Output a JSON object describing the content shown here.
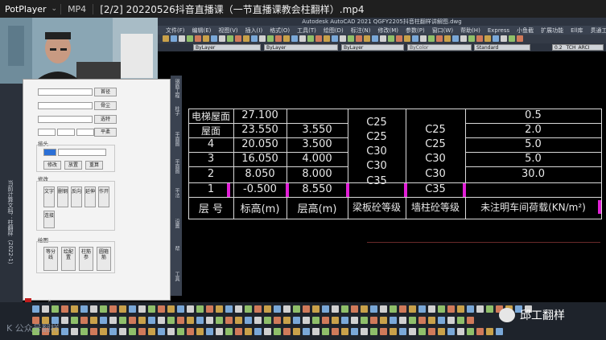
{
  "player": {
    "brand": "PotPlayer",
    "format": "MP4",
    "file_title": "[2/2] 20220526抖音直播课（一节直播课教会柱翻样）.mp4"
  },
  "acad": {
    "window_title": "Autodesk AutoCAD 2021    QGFY2205抖音柱翻样讲解图.dwg",
    "menu": [
      "文件(F)",
      "编辑(E)",
      "视图(V)",
      "插入(I)",
      "格式(O)",
      "工具(T)",
      "绘图(D)",
      "标注(N)",
      "修改(M)",
      "参数(P)",
      "窗口(W)",
      "帮助(H)",
      "Express",
      "小鱼截",
      "扩展功能",
      "Ell库",
      "贯通工具(E)"
    ],
    "layer_combo": "ByLayer",
    "color_combo": "ByLayer",
    "linetype_combo": "ByLayer",
    "plot_combo": "ByColor",
    "text_style": "Standard",
    "dim_style": "0.2 _TCH_ARCI",
    "left_strip_text": "当前计算文档：柱翻样（2022-1）"
  },
  "panel": {
    "buttons": {
      "top1": "首径",
      "top2": "骨尘",
      "top3": "选特",
      "top4": "平柔"
    },
    "group_join": "接头",
    "join_btns": [
      "修改",
      "放置",
      "重算"
    ],
    "group_modify": "修改",
    "modify_btns": [
      "文字",
      "删钢",
      "反向",
      "延伸",
      "作开"
    ],
    "modify_btn2": "连接",
    "group_draw": "绘图",
    "draw_btns": [
      "等分线",
      "绘配置",
      "柱筋参",
      "圆箍筋"
    ]
  },
  "tabs": [
    "钢筋工程",
    "柱子",
    "平面图",
    "平面图",
    "平法",
    "设置",
    "帮",
    "工具"
  ],
  "table": {
    "rows": [
      {
        "floor": "电梯屋面",
        "elev": "27.100",
        "height": "",
        "load": "0.5"
      },
      {
        "floor": "屋面",
        "elev": "23.550",
        "height": "3.550",
        "load": "2.0"
      },
      {
        "floor": "4",
        "elev": "20.050",
        "height": "3.500",
        "load": "5.0"
      },
      {
        "floor": "3",
        "elev": "16.050",
        "height": "4.000",
        "load": "5.0"
      },
      {
        "floor": "2",
        "elev": "8.050",
        "height": "8.000",
        "load": "30.0"
      },
      {
        "floor": "1",
        "elev": "-0.500",
        "height": "8.550",
        "load": ""
      }
    ],
    "beam_grades": [
      "C25",
      "C25",
      "C30",
      "C30",
      "C35"
    ],
    "col_grades": [
      "C25",
      "C25",
      "C30",
      "C30",
      "C35"
    ],
    "header": {
      "floor": "层 号",
      "elev": "标高(m)",
      "height": "层高(m)",
      "beam": "梁板砼等级",
      "col": "墙柱砼等级",
      "load": "未注明车间荷载(KN/m²)"
    }
  },
  "brand_logo": "邱工翻样",
  "watermark": "K 公众号翻样"
}
